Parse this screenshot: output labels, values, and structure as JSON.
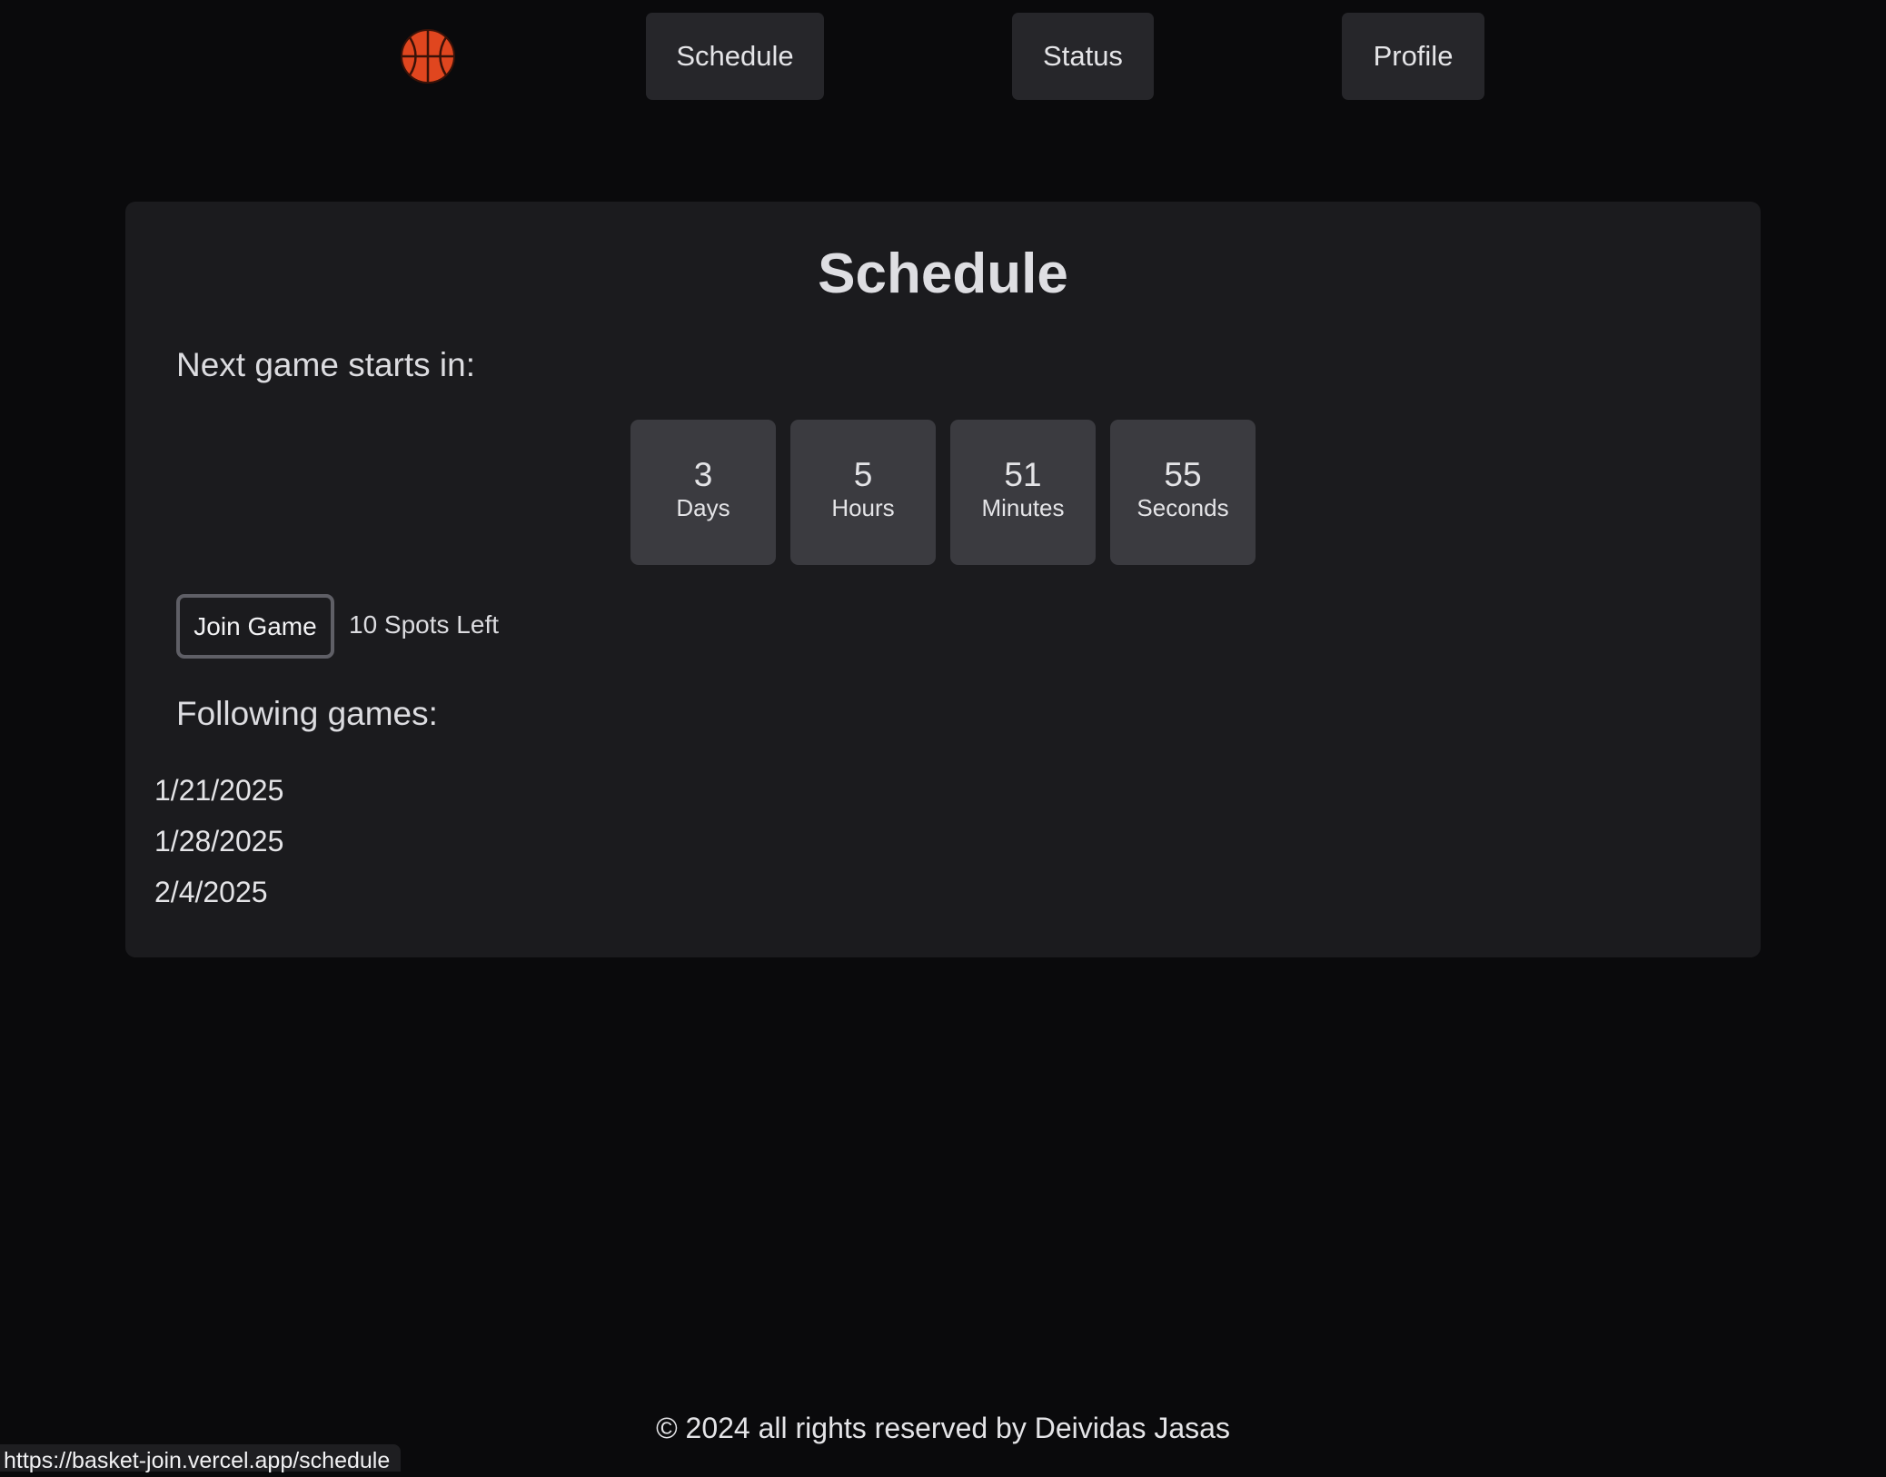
{
  "nav": {
    "logo_icon": "basketball-icon",
    "items": [
      {
        "label": "Schedule"
      },
      {
        "label": "Status"
      },
      {
        "label": "Profile"
      }
    ]
  },
  "schedule": {
    "title": "Schedule",
    "next_label": "Next game starts in:",
    "countdown": [
      {
        "value": "3",
        "unit": "Days"
      },
      {
        "value": "5",
        "unit": "Hours"
      },
      {
        "value": "51",
        "unit": "Minutes"
      },
      {
        "value": "55",
        "unit": "Seconds"
      }
    ],
    "join_label": "Join Game",
    "spots_text": "10 Spots Left",
    "following_label": "Following games:",
    "following_games": [
      "1/21/2025",
      "1/28/2025",
      "2/4/2025"
    ]
  },
  "footer": {
    "text": "© 2024 all rights reserved by Deividas Jasas"
  },
  "browser": {
    "status_url": "https://basket-join.vercel.app/schedule"
  },
  "colors": {
    "background": "#0a0a0c",
    "card": "#1b1b1e",
    "nav_button": "#26262a",
    "countdown_box": "#3b3b40",
    "basketball": "#e0461f"
  }
}
